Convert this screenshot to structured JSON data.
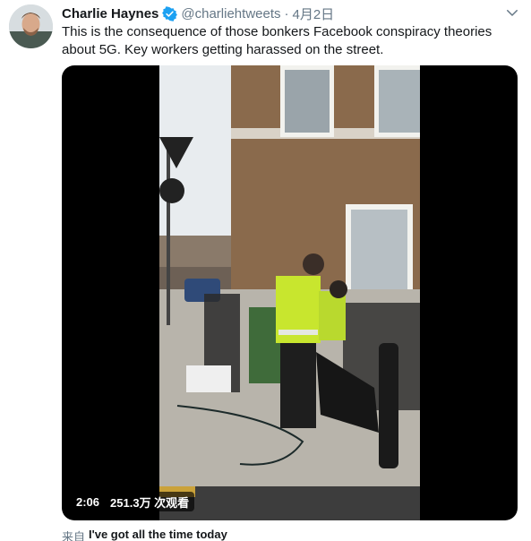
{
  "tweet": {
    "author_name": "Charlie Haynes",
    "handle": "@charliehtweets",
    "separator": "·",
    "date": "4月2日",
    "text": "This is the consequence of those bonkers Facebook conspiracy theories about 5G. Key workers getting harassed on the street.",
    "verified_color": "#1da1f2"
  },
  "video": {
    "duration": "2:06",
    "views": "251.3万 次观看"
  },
  "source": {
    "prefix": "来自",
    "app": "I've got all the time today"
  },
  "icons": {
    "menu": "chevron-down-icon",
    "verified": "verified-badge-icon"
  }
}
